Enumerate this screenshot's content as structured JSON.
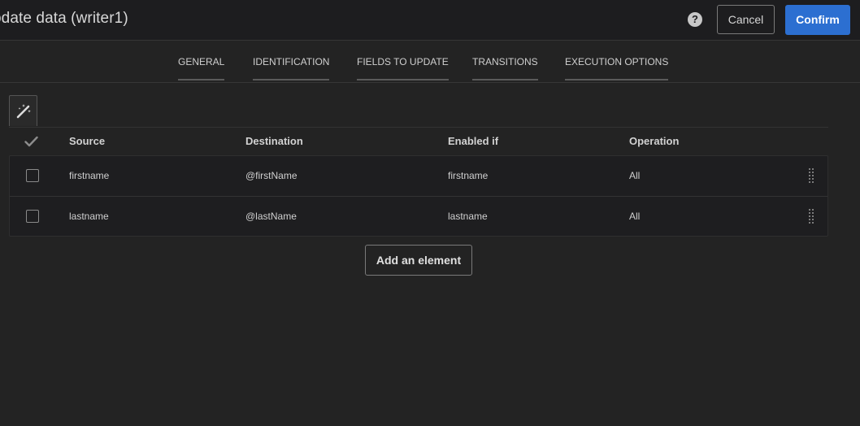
{
  "dialog": {
    "title": "odate data (writer1)",
    "cancel_label": "Cancel",
    "confirm_label": "Confirm",
    "help_glyph": "?",
    "accent_color": "#2c6fd1"
  },
  "tabs": [
    {
      "label": "GENERAL"
    },
    {
      "label": "IDENTIFICATION"
    },
    {
      "label": "FIELDS TO UPDATE"
    },
    {
      "label": "TRANSITIONS"
    },
    {
      "label": "EXECUTION OPTIONS"
    }
  ],
  "toolbar": {
    "icon": "magic-wand-icon"
  },
  "table": {
    "columns": [
      "Source",
      "Destination",
      "Enabled if",
      "Operation"
    ],
    "rows": [
      {
        "source": "firstname",
        "destination": "@firstName",
        "enabled_if": "firstname",
        "operation": "All"
      },
      {
        "source": "lastname",
        "destination": "@lastName",
        "enabled_if": "lastname",
        "operation": "All"
      }
    ]
  },
  "add_element_label": "Add an element"
}
